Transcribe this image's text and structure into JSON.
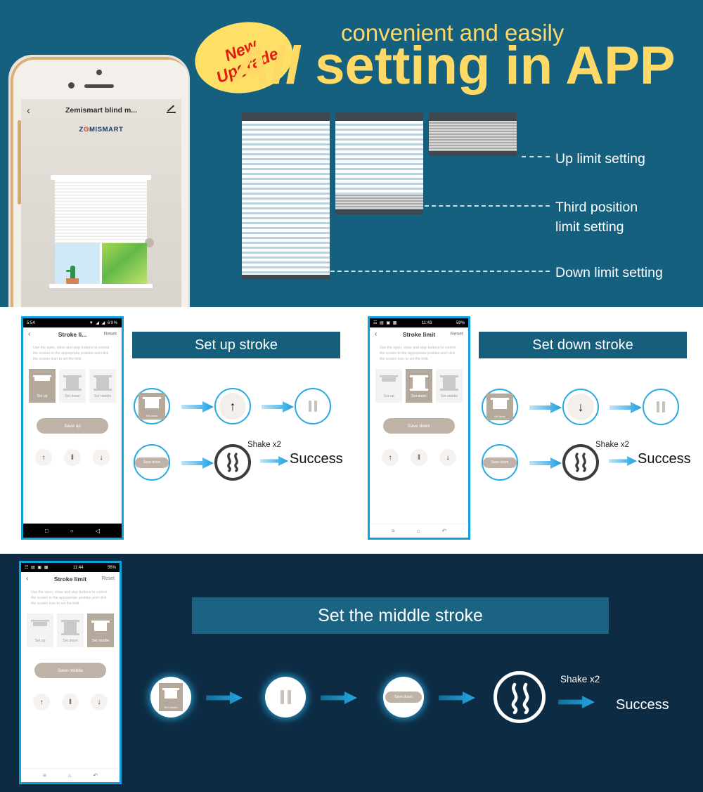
{
  "hero": {
    "badge_line1": "New",
    "badge_line2": "Upgrade",
    "headline_sub": "convenient and easily",
    "headline_a": "A",
    "headline_ll": "ll",
    "headline_rest": " setting in APP",
    "labels": {
      "up": "Up limit setting",
      "third": "Third position\nlimit setting",
      "down": "Down limit setting"
    },
    "phone": {
      "app_title": "Zemismart blind m...",
      "logo_pre": "Z",
      "logo_o": "Θ",
      "logo_post": "MISMART",
      "back_icon": "‹"
    },
    "colors": {
      "bg": "#15607f",
      "accent_yellow": "#ffd966",
      "badge_red": "#e01b0f"
    }
  },
  "section_up": {
    "banner": "Set up stroke",
    "phone": {
      "time": "5:54",
      "battery": "69%",
      "status_icons": "▼ ◢ ◢",
      "back": "‹",
      "title": "Stroke li...",
      "reset": "Reset",
      "desc": "Use the open, close and stop buttons to control the screen to the appropriate position and click the screen icon to set the limit",
      "tiles": [
        {
          "label": "Set up",
          "selected": true
        },
        {
          "label": "Set down",
          "selected": false
        },
        {
          "label": "Set middle",
          "selected": false
        }
      ],
      "save": "Save up",
      "ctrl_up": "↑",
      "ctrl_pause": "‖",
      "ctrl_down": "↓",
      "nav": [
        "□",
        "○",
        "◁"
      ]
    },
    "flow": {
      "step1_label": "Set down",
      "step2_glyph": "↑",
      "step4_label": "Save down",
      "shake": "Shake x2",
      "success": "Success"
    }
  },
  "section_down": {
    "banner": "Set down stroke",
    "phone": {
      "time": "11:43",
      "battery": "59%",
      "status_icons": "☷ ▤ ▣ ▦",
      "back": "‹",
      "title": "Stroke limit",
      "reset": "Reset",
      "desc": "Use the open, close and stop buttons to control the screen to the appropriate position and click the screen icon to set the limit",
      "tiles": [
        {
          "label": "Set up",
          "selected": false
        },
        {
          "label": "Set down",
          "selected": true
        },
        {
          "label": "Set middle",
          "selected": false
        }
      ],
      "save": "Save down",
      "ctrl_up": "↑",
      "ctrl_pause": "‖",
      "ctrl_down": "↓",
      "nav": [
        "≡",
        "⌂",
        "↶"
      ]
    },
    "flow": {
      "step1_label": "Set down",
      "step2_glyph": "↓",
      "step4_label": "Save down",
      "shake": "Shake x2",
      "success": "Success"
    }
  },
  "section_middle": {
    "banner": "Set the middle stroke",
    "phone": {
      "time": "11:44",
      "battery": "56%",
      "status_icons": "☷ ▤ ▣ ▦",
      "back": "‹",
      "title": "Stroke limit",
      "reset": "Reset",
      "desc": "Use the open, close and stop buttons to control the screen to the appropriate position and click the screen icon to set the limit",
      "tiles": [
        {
          "label": "Set up",
          "selected": false
        },
        {
          "label": "Set down",
          "selected": false
        },
        {
          "label": "Set middle",
          "selected": true
        }
      ],
      "save": "Save middle",
      "ctrl_up": "↑",
      "ctrl_pause": "‖",
      "ctrl_down": "↓",
      "nav": [
        "≡",
        "⌂",
        "↶"
      ]
    },
    "flow": {
      "step1_label": "Set middle",
      "step3_label": "Save down",
      "shake": "Shake x2",
      "success": "Success"
    }
  }
}
